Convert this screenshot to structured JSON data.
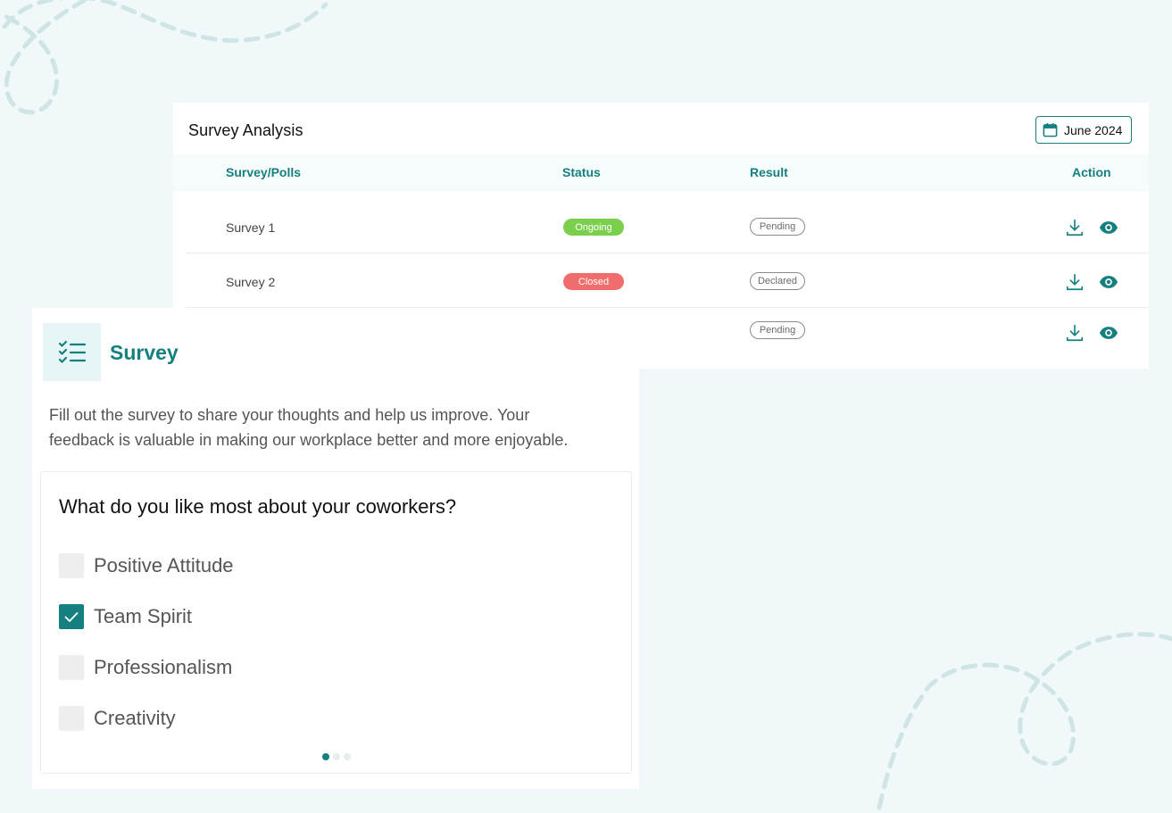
{
  "colors": {
    "accent": "#15807f",
    "ongoing": "#7ccf4c",
    "closed": "#f06d6d",
    "background": "#f1f8f9"
  },
  "analysis": {
    "title": "Survey Analysis",
    "date_filter": {
      "label": "June 2024",
      "icon": "calendar-icon"
    },
    "columns": {
      "name": "Survey/Polls",
      "status": "Status",
      "result": "Result",
      "action": "Action"
    },
    "rows": [
      {
        "name": "Survey 1",
        "status": "Ongoing",
        "result": "Pending"
      },
      {
        "name": "Survey 2",
        "status": "Closed",
        "result": "Declared"
      },
      {
        "name": "",
        "status": "",
        "result": "Pending"
      }
    ],
    "actions": [
      "download-icon",
      "eye-icon"
    ]
  },
  "survey": {
    "icon": "checklist-icon",
    "title": "Survey",
    "description_line1": "Fill out the survey to share your thoughts and help us improve. Your",
    "description_line2": "feedback is valuable in making our workplace better and more enjoyable.",
    "question": "What do you like most about your coworkers?",
    "options": [
      {
        "label": "Positive Attitude",
        "checked": false
      },
      {
        "label": "Team Spirit",
        "checked": true
      },
      {
        "label": "Professionalism",
        "checked": false
      },
      {
        "label": "Creativity",
        "checked": false
      }
    ],
    "pagination": {
      "current": 1,
      "total": 3
    }
  }
}
